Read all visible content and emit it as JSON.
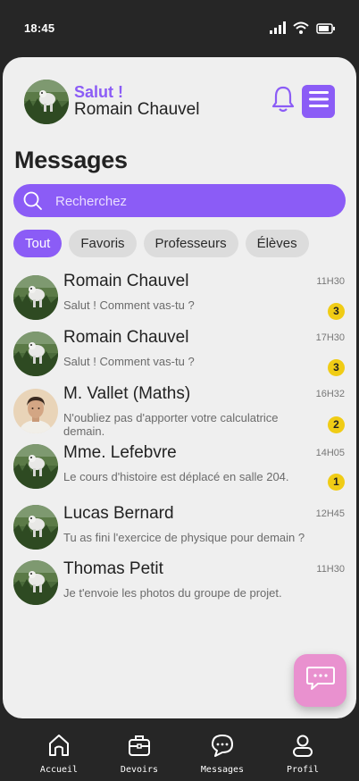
{
  "status_bar": {
    "time": "18:45"
  },
  "header": {
    "greeting": "Salut !",
    "user_name": "Romain Chauvel"
  },
  "page": {
    "title": "Messages"
  },
  "search": {
    "placeholder": "Recherchez"
  },
  "filters": [
    "Tout",
    "Favoris",
    "Professeurs",
    "Élèves"
  ],
  "conversations": [
    {
      "name": "Romain Chauvel",
      "time": "11H30",
      "preview": "Salut ! Comment vas-tu ?",
      "unread": "3",
      "avatar": "nature"
    },
    {
      "name": "Romain Chauvel",
      "time": "17H30",
      "preview": "Salut ! Comment vas-tu ?",
      "unread": "3",
      "avatar": "nature"
    },
    {
      "name": "M. Vallet (Maths)",
      "time": "16H32",
      "preview": "N'oubliez pas d'apporter votre calculatrice demain.",
      "unread": "2",
      "avatar": "person"
    },
    {
      "name": "Mme. Lefebvre",
      "time": "14H05",
      "preview": "Le cours d'histoire est déplacé en salle 204.",
      "unread": "1",
      "avatar": "nature"
    },
    {
      "name": "Lucas Bernard",
      "time": "12H45",
      "preview": "Tu as fini l'exercice de physique pour demain ?",
      "unread": "",
      "avatar": "nature"
    },
    {
      "name": "Thomas Petit",
      "time": "11H30",
      "preview": "Je t'envoie les photos du groupe de projet.",
      "unread": "",
      "avatar": "nature"
    }
  ],
  "nav": [
    {
      "label": "Accueil",
      "icon": "home-icon"
    },
    {
      "label": "Devoirs",
      "icon": "briefcase-icon"
    },
    {
      "label": "Messages",
      "icon": "chat-icon"
    },
    {
      "label": "Profil",
      "icon": "user-icon"
    }
  ],
  "colors": {
    "accent": "#8b5cf6",
    "badge": "#f0cc15",
    "fab": "#e991cf",
    "background": "#262626",
    "card": "#efefef"
  }
}
